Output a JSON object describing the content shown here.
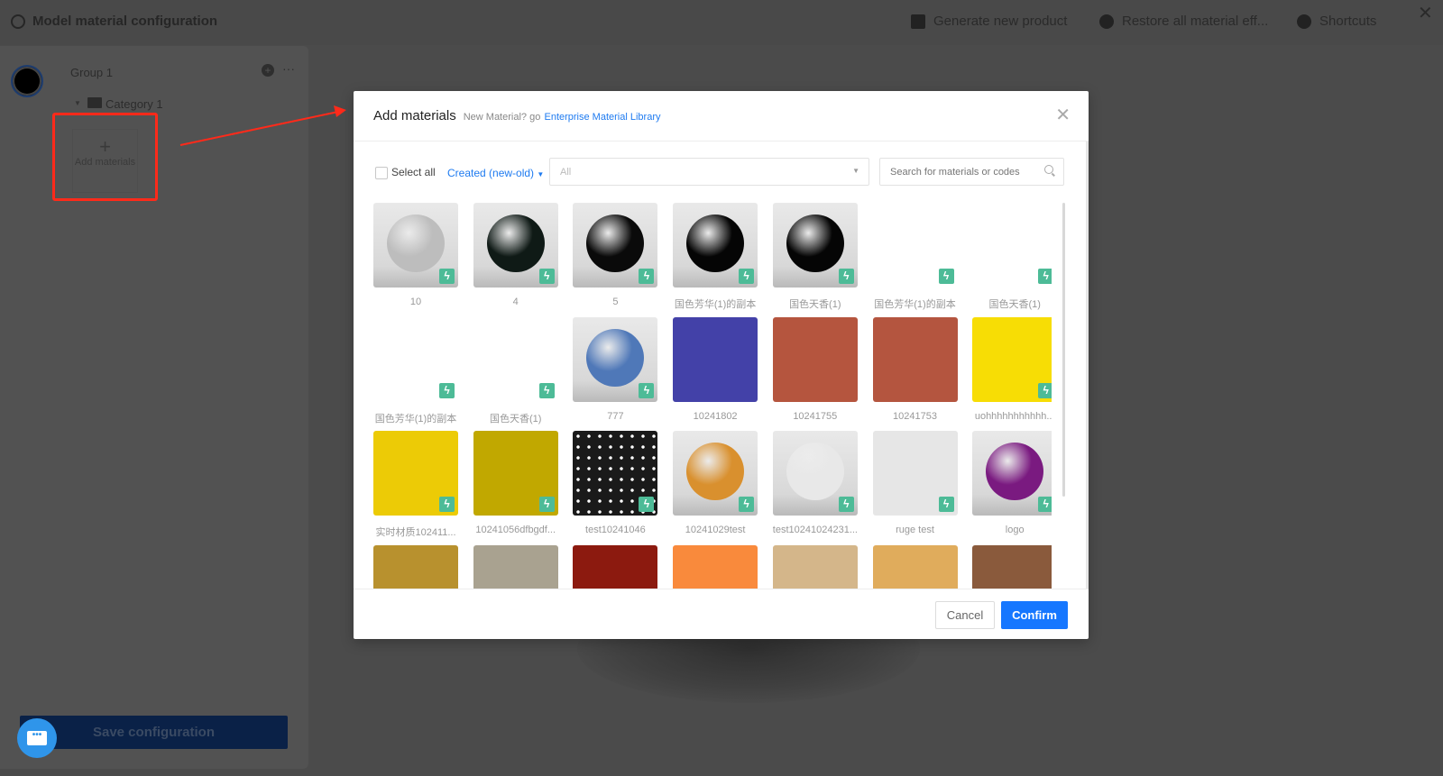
{
  "app": {
    "title": "Model material configuration"
  },
  "toolbar": {
    "generate": "Generate new product",
    "restore": "Restore all material eff...",
    "shortcuts": "Shortcuts"
  },
  "sidebar": {
    "group": "Group 1",
    "category": "Category 1",
    "add_materials": "Add materials",
    "save": "Save configuration"
  },
  "modal": {
    "title": "Add materials",
    "subtitle": "New Material? go",
    "link": "Enterprise Material Library",
    "select_all": "Select all",
    "sort": "Created (new-old)",
    "filter_value": "All",
    "search_placeholder": "Search for materials or codes",
    "cancel": "Cancel",
    "confirm": "Confirm",
    "materials": [
      {
        "label": "10",
        "kind": "sphere",
        "color": "#bdbdbd",
        "badge": true
      },
      {
        "label": "4",
        "kind": "sphere",
        "color": "#0f1a16",
        "badge": true
      },
      {
        "label": "5",
        "kind": "sphere",
        "color": "#0a0a0a",
        "badge": true
      },
      {
        "label": "国色芳华(1)的副本",
        "kind": "sphere",
        "color": "#050505",
        "badge": true
      },
      {
        "label": "国色天香(1)",
        "kind": "sphere",
        "color": "#050505",
        "badge": true
      },
      {
        "label": "国色芳华(1)的副本",
        "kind": "blank",
        "color": "#ffffff",
        "badge": true
      },
      {
        "label": "国色天香(1)",
        "kind": "blank",
        "color": "#ffffff",
        "badge": true
      },
      {
        "label": "国色芳华(1)的副本",
        "kind": "blank",
        "color": "#ffffff",
        "badge": true
      },
      {
        "label": "国色天香(1)",
        "kind": "blank",
        "color": "#ffffff",
        "badge": true
      },
      {
        "label": "777",
        "kind": "sphere",
        "color": "#4f78b8",
        "badge": true
      },
      {
        "label": "10241802",
        "kind": "swatch",
        "color": "#4341a8",
        "badge": false
      },
      {
        "label": "10241755",
        "kind": "swatch",
        "color": "#b5553e",
        "badge": false
      },
      {
        "label": "10241753",
        "kind": "swatch",
        "color": "#b4553f",
        "badge": false
      },
      {
        "label": "uohhhhhhhhhhh...",
        "kind": "swatch",
        "color": "#f7dd05",
        "badge": true
      },
      {
        "label": "实时材质102411...",
        "kind": "swatch",
        "color": "#eccb06",
        "badge": true
      },
      {
        "label": "10241056dfbgdf...",
        "kind": "swatch",
        "color": "#c1a800",
        "badge": true
      },
      {
        "label": "test10241046",
        "kind": "dots",
        "color": "#1a1a1a",
        "badge": true
      },
      {
        "label": "10241029test",
        "kind": "sphere",
        "color": "#d9902e",
        "badge": true
      },
      {
        "label": "test10241024231...",
        "kind": "sphere",
        "color": "#e8e8e8",
        "badge": true
      },
      {
        "label": "ruge test",
        "kind": "swatch",
        "color": "#e6e6e6",
        "badge": true
      },
      {
        "label": "logo",
        "kind": "sphere",
        "color": "#7a1a80",
        "badge": true
      },
      {
        "label": "",
        "kind": "swatch",
        "color": "#b8912e",
        "badge": false
      },
      {
        "label": "",
        "kind": "swatch",
        "color": "#a9a290",
        "badge": false
      },
      {
        "label": "",
        "kind": "swatch",
        "color": "#8c1a0f",
        "badge": false
      },
      {
        "label": "",
        "kind": "swatch",
        "color": "#f98a3c",
        "badge": false
      },
      {
        "label": "",
        "kind": "swatch",
        "color": "#d4b68a",
        "badge": false
      },
      {
        "label": "",
        "kind": "swatch",
        "color": "#e0ac5c",
        "badge": false
      },
      {
        "label": "",
        "kind": "swatch",
        "color": "#8a5a3c",
        "badge": false
      }
    ]
  },
  "colors": {
    "accent": "#1677ff",
    "badge": "#4dbb97",
    "annotation": "#ff2a1a"
  }
}
